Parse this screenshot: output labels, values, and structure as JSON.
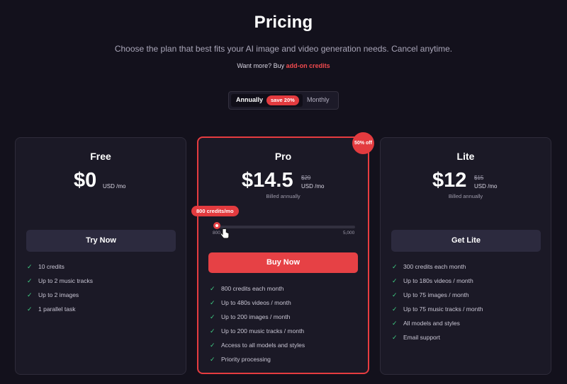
{
  "header": {
    "title": "Pricing",
    "subtitle": "Choose the plan that best fits your AI image and video generation needs. Cancel anytime.",
    "addon_prefix": "Want more? Buy ",
    "addon_link": "add-on credits"
  },
  "billing_toggle": {
    "annually_label": "Annually",
    "save_badge": "save 20%",
    "monthly_label": "Monthly",
    "selected": "Annually"
  },
  "colors": {
    "background": "#13111c",
    "card": "#1b1926",
    "accent_red": "#e64145",
    "check_green": "#3fcf84"
  },
  "plans": {
    "free": {
      "name": "Free",
      "price": "$0",
      "unit": "USD /mo",
      "button": "Try Now",
      "features": [
        "10 credits",
        "Up to 2 music tracks",
        "Up to 2 images",
        "1 parallel task"
      ]
    },
    "pro": {
      "name": "Pro",
      "price": "$14.5",
      "old_price": "$29",
      "unit": "USD /mo",
      "billed": "Billed annually",
      "discount_badge": "50% off",
      "slider": {
        "tooltip": "800 credits/mo",
        "min_label": "800",
        "max_label": "5,000",
        "value": 800,
        "min": 800,
        "max": 5000
      },
      "button": "Buy Now",
      "features": [
        "800 credits each month",
        "Up to 480s videos / month",
        "Up to 200 images / month",
        "Up to 200 music tracks / month",
        "Access to all models and styles",
        "Priority processing"
      ]
    },
    "lite": {
      "name": "Lite",
      "price": "$12",
      "old_price": "$15",
      "unit": "USD /mo",
      "billed": "Billed annually",
      "button": "Get Lite",
      "features": [
        "300 credits each month",
        "Up to 180s videos / month",
        "Up to 75 images / month",
        "Up to 75 music tracks / month",
        "All models and styles",
        "Email support"
      ]
    }
  },
  "icons": {
    "check": "check-icon",
    "cursor": "hand-pointer-icon"
  }
}
